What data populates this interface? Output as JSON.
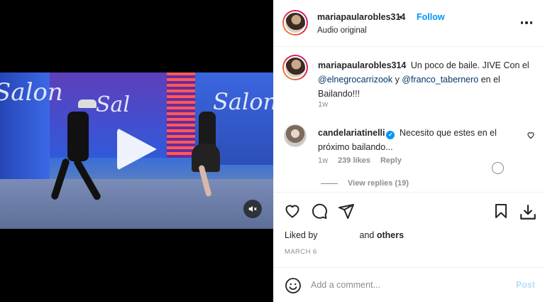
{
  "post": {
    "username": "mariapaularobles314",
    "separator": "•",
    "follow_label": "Follow",
    "audio_label": "Audio original"
  },
  "video": {
    "signs": [
      "Salon",
      "Sal",
      "Salon"
    ]
  },
  "caption": {
    "username": "mariapaularobles314",
    "text_1": "Un poco de baile. JIVE Con el",
    "mention_1": "@elnegrocarrizook",
    "text_2": "y",
    "mention_2": "@franco_taberner​o",
    "text_3": "en el Bailando!!!",
    "time": "1w"
  },
  "comment": {
    "username": "candelariatinelli",
    "verified_mark": "✓",
    "text": "Necesito que estes en el próximo bailando...",
    "time": "1w",
    "likes": "239 likes",
    "reply_label": "Reply",
    "view_replies": "View replies (19)"
  },
  "actions": {
    "liked_by_prefix": "Liked by",
    "liked_by_suffix_and": "and",
    "liked_by_others": "others",
    "date": "MARCH 6"
  },
  "add_comment": {
    "placeholder": "Add a comment...",
    "post_label": "Post"
  },
  "icons": [
    "more-icon",
    "play-icon",
    "mute-icon",
    "heart-icon",
    "comment-icon",
    "share-icon",
    "save-icon",
    "download-icon",
    "emoji-icon"
  ],
  "colors": {
    "link_blue": "#0095f6",
    "mention_blue": "#00376b",
    "muted_gray": "#8e8e8e",
    "post_disabled": "#b2dffc"
  }
}
